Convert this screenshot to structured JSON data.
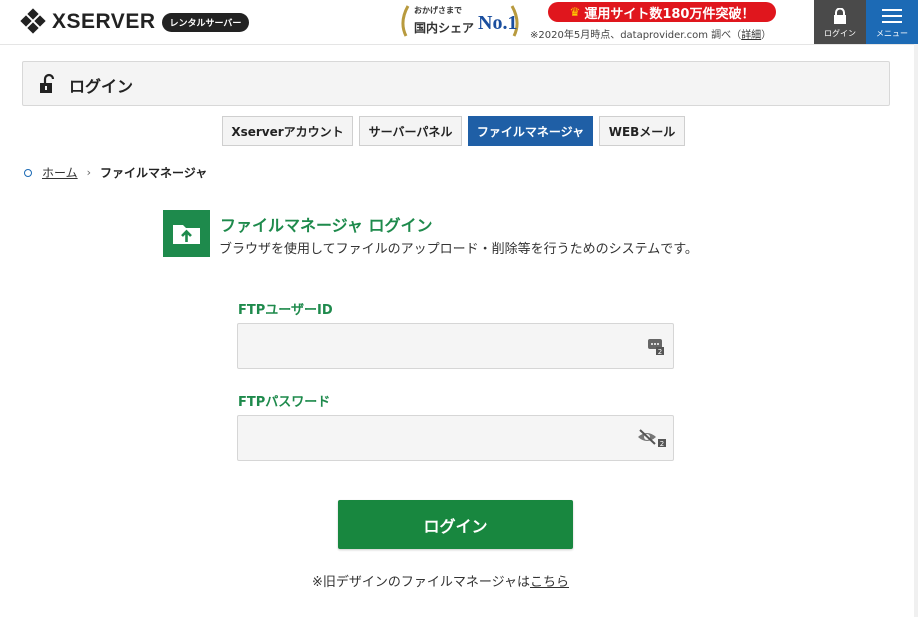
{
  "header": {
    "logo_text": "XSERVER",
    "logo_badge": "レンタルサーバー",
    "award_line1": "おかげさまで",
    "award_line2": "国内シェア",
    "award_no1": "No.1",
    "promo_text": "運用サイト数180万件突破！",
    "promo_note_prefix": "※2020年5月時点、dataprovider.com 調べ（",
    "promo_note_link": "詳細",
    "promo_note_suffix": "）",
    "login_button_label": "ログイン",
    "menu_button_label": "メニュー"
  },
  "titlebar": {
    "title": "ログイン"
  },
  "tabs": [
    {
      "label": "Xserverアカウント",
      "active": false
    },
    {
      "label": "サーバーパネル",
      "active": false
    },
    {
      "label": "ファイルマネージャ",
      "active": true
    },
    {
      "label": "WEBメール",
      "active": false
    }
  ],
  "breadcrumb": {
    "home": "ホーム",
    "separator": "›",
    "current": "ファイルマネージャ"
  },
  "main": {
    "title": "ファイルマネージャ ログイン",
    "description": "ブラウザを使用してファイルのアップロード・削除等を行うためのシステムです。",
    "user_label": "FTPユーザーID",
    "user_value": "",
    "password_label": "FTPパスワード",
    "password_value": "",
    "login_button": "ログイン",
    "old_design_prefix": "※旧デザインのファイルマネージャは",
    "old_design_link": "こちら"
  },
  "colors": {
    "brand_green": "#1e8a4c",
    "active_tab": "#1f5fa6",
    "promo_red": "#e0161d",
    "menu_blue": "#1c6ab5"
  }
}
